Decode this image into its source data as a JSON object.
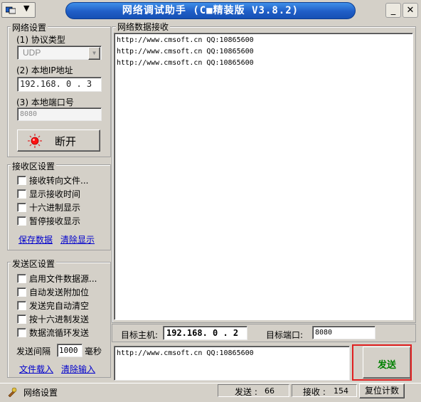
{
  "window": {
    "title": "网络调试助手 (C■精装版 V3.8.2)",
    "minimize_glyph": "_",
    "close_glyph": "✕"
  },
  "network_settings": {
    "group_label": "网络设置",
    "protocol_label": "(1) 协议类型",
    "protocol_value": "UDP",
    "local_ip_label": "(2) 本地IP地址",
    "local_ip_value": "192.168. 0 . 3",
    "local_port_label": "(3) 本地端口号",
    "local_port_value": "8080",
    "disconnect_label": "断开"
  },
  "receive_settings": {
    "group_label": "接收区设置",
    "options": [
      "接收转向文件...",
      "显示接收时间",
      "十六进制显示",
      "暂停接收显示"
    ],
    "save_link": "保存数据",
    "clear_link": "清除显示"
  },
  "send_settings": {
    "group_label": "发送区设置",
    "options": [
      "启用文件数据源...",
      "自动发送附加位",
      "发送完自动清空",
      "按十六进制发送",
      "数据流循环发送"
    ],
    "interval_label": "发送间隔",
    "interval_value": "1000",
    "interval_unit": "毫秒",
    "load_file_link": "文件载入",
    "clear_input_link": "清除输入"
  },
  "receive_panel": {
    "group_label": "网络数据接收",
    "lines": [
      "http://www.cmsoft.cn QQ:10865600",
      "http://www.cmsoft.cn QQ:10865600",
      "http://www.cmsoft.cn QQ:10865600"
    ]
  },
  "target": {
    "host_label": "目标主机:",
    "host_value": "192.168. 0 . 2",
    "port_label": "目标端口:",
    "port_value": "8080"
  },
  "send_panel": {
    "text": "http://www.cmsoft.cn QQ:10865600",
    "send_button": "发送"
  },
  "status_bar": {
    "status_text": "网络设置",
    "send_label": "发送 :",
    "send_count": "66",
    "recv_label": "接收 :",
    "recv_count": "154",
    "reset_label": "复位计数"
  },
  "colors": {
    "title_blue": "#1f5ec7",
    "send_green": "#008000",
    "highlight_red": "#e02020",
    "link_blue": "#0000cc"
  }
}
